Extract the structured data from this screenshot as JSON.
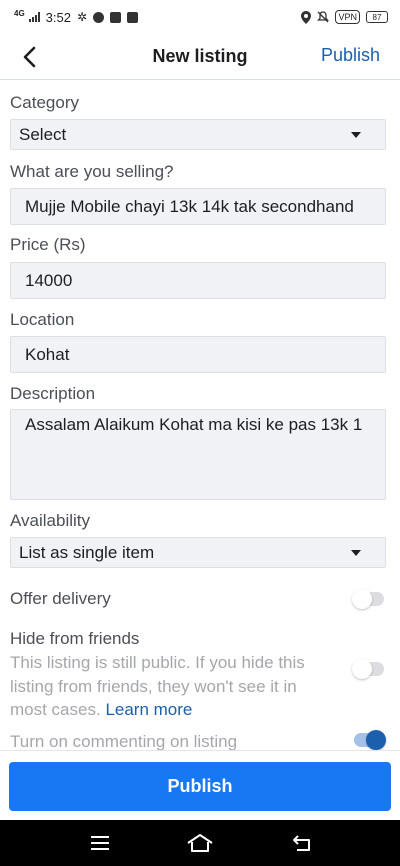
{
  "status_bar": {
    "network": "4G",
    "time": "3:52",
    "vpn": "VPN",
    "battery": "87"
  },
  "header": {
    "title": "New listing",
    "publish_link": "Publish"
  },
  "form": {
    "category": {
      "label": "Category",
      "value": "Select"
    },
    "selling": {
      "label": "What are you selling?",
      "value": "Mujje Mobile chayi 13k 14k tak secondhand"
    },
    "price": {
      "label": "Price (Rs)",
      "value": "14000"
    },
    "location": {
      "label": "Location",
      "value": "Kohat"
    },
    "description": {
      "label": "Description",
      "value": "Assalam Alaikum Kohat ma kisi ke pas 13k 1"
    },
    "availability": {
      "label": "Availability",
      "value": "List as single item"
    },
    "offer_delivery": {
      "label": "Offer delivery",
      "enabled": false
    },
    "hide_from_friends": {
      "label": "Hide from friends",
      "help": "This listing is still public. If you hide this listing from friends, they won't see it in most cases.",
      "learn_more": "Learn more",
      "enabled": false
    },
    "commenting": {
      "label": "Turn on commenting on listing",
      "enabled": true
    }
  },
  "footer": {
    "publish_button": "Publish"
  },
  "colors": {
    "accent": "#1877f2",
    "link": "#1b5fad",
    "field_bg": "#f0f2f5"
  }
}
